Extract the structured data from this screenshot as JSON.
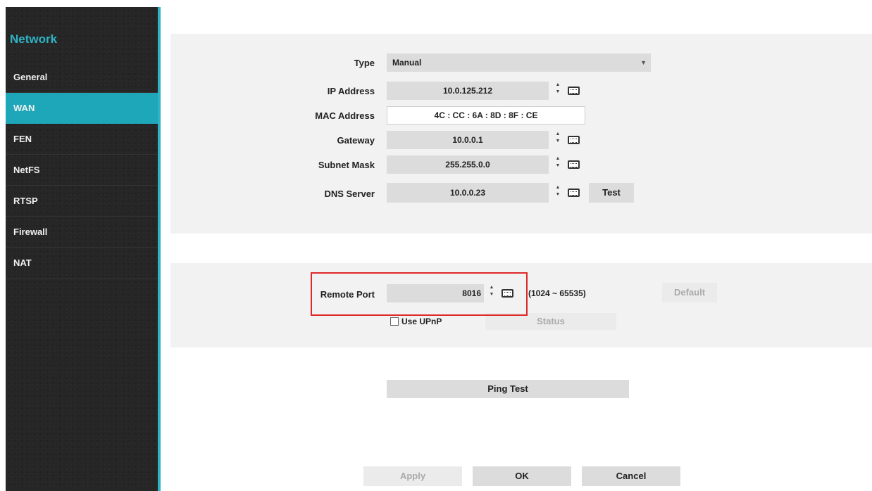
{
  "sidebar": {
    "title": "Network",
    "items": [
      {
        "label": "General",
        "active": false
      },
      {
        "label": "WAN",
        "active": true
      },
      {
        "label": "FEN",
        "active": false
      },
      {
        "label": "NetFS",
        "active": false
      },
      {
        "label": "RTSP",
        "active": false
      },
      {
        "label": "Firewall",
        "active": false
      },
      {
        "label": "NAT",
        "active": false
      }
    ]
  },
  "wan": {
    "type": {
      "label": "Type",
      "value": "Manual"
    },
    "ip_address": {
      "label": "IP Address",
      "value": "10.0.125.212"
    },
    "mac_address": {
      "label": "MAC Address",
      "value": "4C : CC : 6A : 8D : 8F : CE"
    },
    "gateway": {
      "label": "Gateway",
      "value": "10.0.0.1"
    },
    "subnet_mask": {
      "label": "Subnet Mask",
      "value": "255.255.0.0"
    },
    "dns_server": {
      "label": "DNS Server",
      "value": "10.0.0.23",
      "test_label": "Test"
    }
  },
  "port": {
    "label": "Remote Port",
    "value": "8016",
    "range": "(1024 ~ 65535)",
    "default_label": "Default",
    "upnp_label": "Use UPnP",
    "status_label": "Status"
  },
  "ping_test_label": "Ping Test",
  "footer": {
    "apply": "Apply",
    "ok": "OK",
    "cancel": "Cancel"
  },
  "colors": {
    "accent": "#1da7b8",
    "sidebar_bg": "#262626",
    "highlight": "#e02828"
  }
}
